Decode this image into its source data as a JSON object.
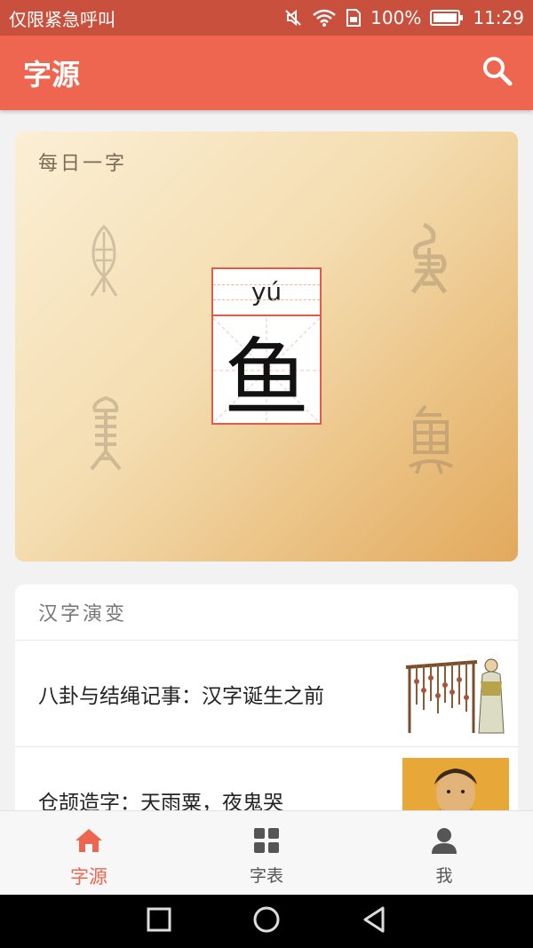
{
  "status_bar": {
    "carrier": "仅限紧急呼叫",
    "battery": "100%",
    "time": "11:29"
  },
  "app_bar": {
    "title": "字源"
  },
  "daily": {
    "title": "每日一字",
    "pinyin": "yú",
    "character": "鱼"
  },
  "evolution": {
    "title": "汉字演变",
    "articles": [
      {
        "title": "八卦与结绳记事：汉字诞生之前"
      },
      {
        "title": "仓颉造字：天雨粟，夜鬼哭"
      }
    ]
  },
  "bottom_nav": {
    "items": [
      {
        "label": "字源",
        "active": true
      },
      {
        "label": "字表",
        "active": false
      },
      {
        "label": "我",
        "active": false
      }
    ]
  },
  "colors": {
    "status_bar": "#c9503c",
    "app_bar": "#ef6650",
    "accent": "#ef6650"
  }
}
